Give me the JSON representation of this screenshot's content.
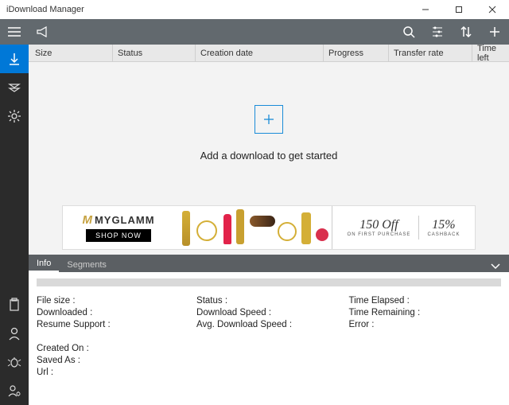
{
  "window": {
    "title": "iDownload Manager"
  },
  "columns": [
    "Size",
    "Status",
    "Creation date",
    "Progress",
    "Transfer rate",
    "Time left"
  ],
  "empty": {
    "message": "Add a download to get started"
  },
  "ad": {
    "brand": "MYGLAMM",
    "cta": "SHOP NOW",
    "offer1_big": "150 Off",
    "offer1_small": "ON FIRST PURCHASE",
    "offer2_big": "15%",
    "offer2_small": "CASHBACK"
  },
  "tabs": {
    "info": "Info",
    "segments": "Segments"
  },
  "details": {
    "file_size_label": "File size :",
    "downloaded_label": "Downloaded :",
    "resume_label": "Resume Support :",
    "created_label": "Created On :",
    "saved_label": "Saved As :",
    "url_label": "Url :",
    "status_label": "Status :",
    "dspeed_label": "Download Speed :",
    "avgspeed_label": "Avg. Download Speed :",
    "elapsed_label": "Time Elapsed :",
    "remaining_label": "Time Remaining :",
    "error_label": "Error :"
  }
}
